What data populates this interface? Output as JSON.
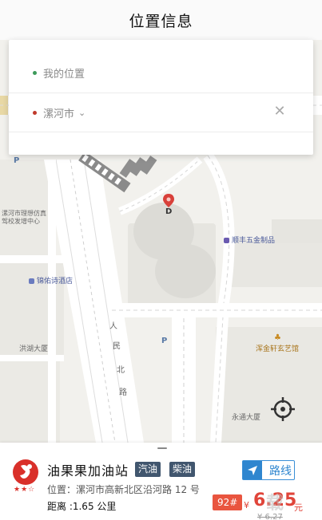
{
  "header": {
    "title": "位置信息"
  },
  "search": {
    "origin_label": "我的位置",
    "destination_label": "漯河市",
    "destination_chevron_icon": "chevron-down-icon",
    "close_icon": "close-icon"
  },
  "map": {
    "labels": {
      "building_west": "漯河市理想仿真",
      "building_west_2": "驾校发增中心",
      "hotel": "锦佑诗酒店",
      "tower_west": "洪湖大厦",
      "shop": "顺丰五金制品",
      "art_shop": "浑金轩玄艺馆",
      "tower_south": "永通大厦",
      "road_chars": [
        "人",
        "民",
        "北",
        "路"
      ],
      "parking": "P"
    },
    "pin_label": "D",
    "locate_icon": "crosshair-icon"
  },
  "station": {
    "name": "油果果加油站",
    "tags": [
      "汽油",
      "柴油"
    ],
    "address": "位置：漯河市高新北区沿河路 12 号",
    "distance": "距离 :1.65 公里",
    "rating_stars": "★★☆",
    "route_label": "路线",
    "route_icon": "navigate-arrow-icon",
    "fuel_grade": "92#",
    "currency": "¥",
    "price": "6.25",
    "price_unit": "元",
    "old_price": "¥ 6.27",
    "watermark": "载"
  },
  "colors": {
    "accent_blue": "#2f86cf",
    "tag_bg": "#41566e",
    "price_red": "#e0453a",
    "badge_red": "#e9553f"
  }
}
